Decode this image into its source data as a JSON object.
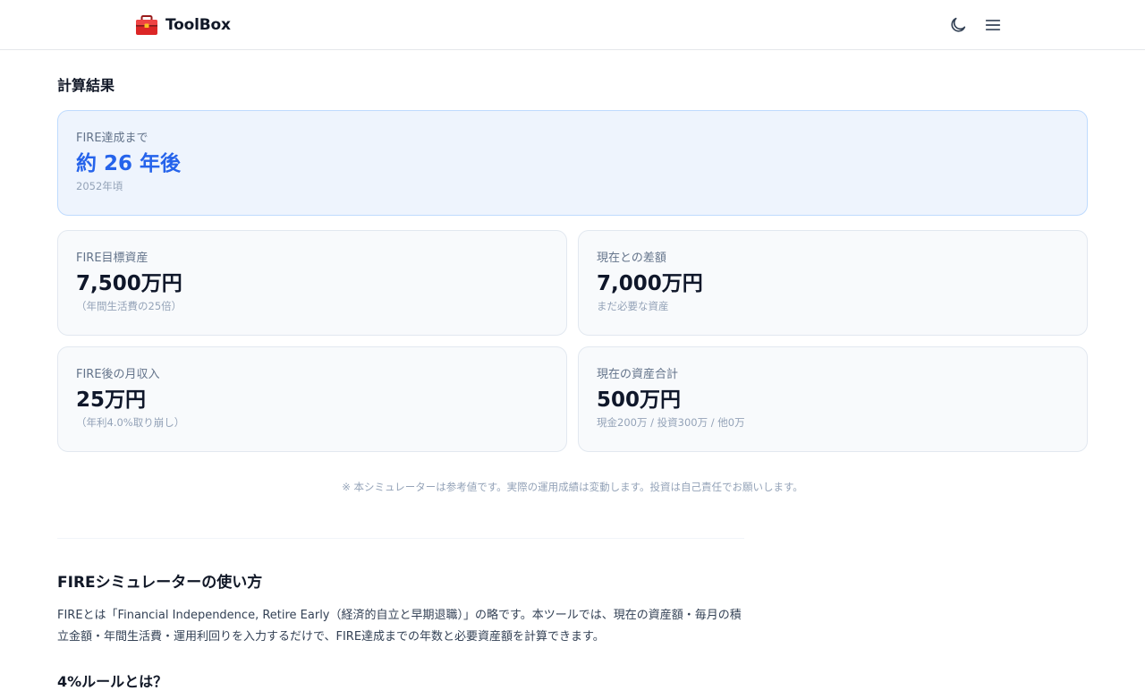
{
  "header": {
    "brand": "ToolBox",
    "logo_icon": "toolbox-icon",
    "theme_icon": "moon-icon",
    "menu_icon": "hamburger-menu-icon",
    "accent_color": "#2563eb"
  },
  "results": {
    "title": "計算結果",
    "fire_years": {
      "label": "FIRE達成まで",
      "value": "約 26 年後",
      "sub": "2052年頃"
    },
    "target_assets": {
      "label": "FIRE目標資産",
      "value": "7,500万円",
      "sub": "（年間生活費の25倍）"
    },
    "difference": {
      "label": "現在との差額",
      "value": "7,000万円",
      "sub": "まだ必要な資産"
    },
    "monthly_income": {
      "label": "FIRE後の月収入",
      "value": "25万円",
      "sub": "（年利4.0%取り崩し）"
    },
    "current_assets": {
      "label": "現在の資産合計",
      "value": "500万円",
      "sub": "現金200万 / 投資300万 / 他0万"
    },
    "disclaimer": "※ 本シミュレーターは参考値です。実際の運用成績は変動します。投資は自己責任でお願いします。"
  },
  "guide": {
    "title": "FIREシミュレーターの使い方",
    "text": "FIREとは「Financial Independence, Retire Early（経済的自立と早期退職）」の略です。本ツールでは、現在の資産額・毎月の積立金額・年間生活費・運用利回りを入力するだけで、FIRE達成までの年数と必要資産額を計算できます。",
    "subheading": "4%ルールとは？"
  }
}
